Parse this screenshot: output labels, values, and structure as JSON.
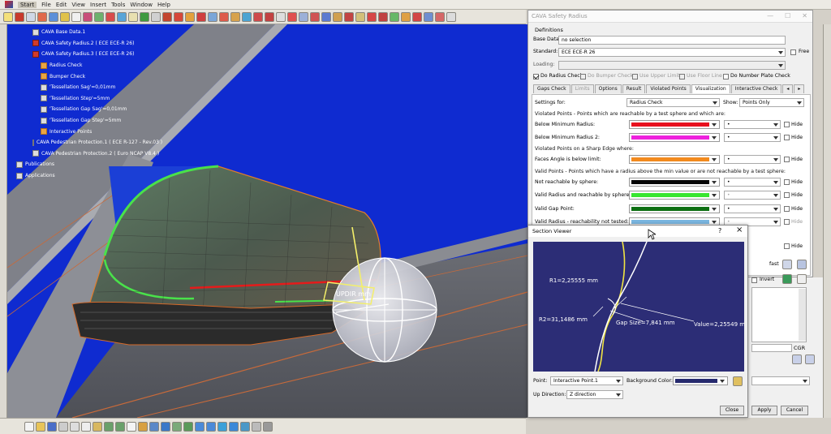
{
  "menu": {
    "items": [
      "Start",
      "File",
      "Edit",
      "View",
      "Insert",
      "Tools",
      "Window",
      "Help"
    ]
  },
  "tree": {
    "nodes": [
      {
        "label": "CAVA Base Data.1",
        "icon": "gear-icon"
      },
      {
        "label": "CAVA Safety Radius.2 ( ECE ECE-R 26)",
        "icon": "radius-icon"
      },
      {
        "label": "CAVA Safety Radius.3 ( ECE ECE-R 26)",
        "icon": "radius-icon"
      },
      {
        "label": "Radius Check",
        "icon": "folder-icon"
      },
      {
        "label": "Bumper Check",
        "icon": "folder-icon"
      },
      {
        "label": "'Tessellation Sag'=0,01mm",
        "icon": "parameter-icon"
      },
      {
        "label": "'Tessellation Step'=5mm",
        "icon": "parameter-icon"
      },
      {
        "label": "'Tessellation Gap Sag'=0,01mm",
        "icon": "parameter-icon"
      },
      {
        "label": "'Tessellation Gap Step'=5mm",
        "icon": "parameter-icon"
      },
      {
        "label": "Interactive Points",
        "icon": "folder-icon"
      },
      {
        "label": "CAVA Pedestrian Protection.1 ( ECE R-127 - Rev.03 )",
        "icon": "pedestrian-icon"
      },
      {
        "label": "CAVA Pedestrian Protection.2 ( Euro NCAP V8.4 )",
        "icon": "pedestrian-icon"
      },
      {
        "label": "Publications",
        "icon": "publications-icon"
      },
      {
        "label": "Applications",
        "icon": "applications-icon"
      }
    ]
  },
  "viewport": {
    "label_up_direction": "UPDIR mm"
  },
  "safety_dialog": {
    "title": "CAVA Safety Radius",
    "definitions_label": "Definitions",
    "base_data_label": "Base Data:",
    "base_data_value": "no selection",
    "standard_label": "Standard:",
    "standard_value": "ECE ECE-R 26",
    "free_label": "Free",
    "loading_label": "Loading:",
    "checks": [
      {
        "label": "Do Radius Check",
        "checked": true,
        "enabled": true
      },
      {
        "label": "Do Bumper Check",
        "checked": false,
        "enabled": false
      },
      {
        "label": "Use Upper Limit",
        "checked": false,
        "enabled": false
      },
      {
        "label": "Use Floor Line",
        "checked": false,
        "enabled": false
      },
      {
        "label": "Do Number Plate Check",
        "checked": false,
        "enabled": true
      }
    ],
    "tabs": [
      {
        "label": "Gaps Check",
        "state": "normal"
      },
      {
        "label": "Limits",
        "state": "disabled"
      },
      {
        "label": "Options",
        "state": "normal"
      },
      {
        "label": "Result",
        "state": "normal"
      },
      {
        "label": "Violated Points",
        "state": "normal"
      },
      {
        "label": "Visualization",
        "state": "selected"
      },
      {
        "label": "Interactive Check",
        "state": "normal"
      }
    ],
    "settings_for_label": "Settings for:",
    "settings_for_value": "Radius Check",
    "show_label": "Show:",
    "show_value": "Points Only",
    "section_violated": "Violated Points - Points which are reachable by a test sphere and which are:",
    "section_sharp": "Violated Points on a Sharp Edge where:",
    "section_valid": "Valid Points - Points which have a radius above the min value or are not reachable by a test sphere:",
    "hide_label": "Hide",
    "rows_violated": [
      {
        "label": "Below Minimum Radius:",
        "color": "#e8101e",
        "symbol": "•",
        "enabled": true
      },
      {
        "label": "Below Minimum Radius 2:",
        "color": "#ee22dd",
        "symbol": "•",
        "enabled": true
      }
    ],
    "rows_sharp": [
      {
        "label": "Faces Angle is below limit:",
        "color": "#f28a1e",
        "symbol": "•",
        "enabled": true
      }
    ],
    "rows_valid": [
      {
        "label": "Not reachable by sphere:",
        "color": "#050505",
        "symbol": "•",
        "enabled": true
      },
      {
        "label": "Valid Radius and reachable by sphere:",
        "color": "#38e630",
        "symbol": "•",
        "enabled": false
      },
      {
        "label": "Valid Gap Point:",
        "color": "#0c6e12",
        "symbol": "•",
        "enabled": true
      },
      {
        "label": "Valid Radius - reachability not tested:",
        "color": "#7ab6e0",
        "symbol": "•",
        "enabled": false
      }
    ],
    "fast_label": "fast",
    "invert_label": "Invert",
    "cgr_label": "CGR",
    "apply_label": "Apply",
    "cancel_label": "Cancel"
  },
  "section_viewer": {
    "title": "Section Viewer",
    "help_label": "?",
    "close_x": "×",
    "annotations": {
      "r1": "R1=2,25555 mm",
      "r2": "R2=31,1486 mm",
      "gap": "Gap Size=7,841 mm",
      "value": "Value=2,25549 mm"
    },
    "point_label": "Point:",
    "point_value": "Interactive Point.1",
    "bg_color_label": "Background Color:",
    "bg_color_value": "#262a6e",
    "up_dir_label": "Up Direction:",
    "up_dir_value": "Z direction",
    "close_label": "Close"
  },
  "colors": {
    "viewport_blue": "#0f2bd0",
    "accent": "#0078d7"
  }
}
